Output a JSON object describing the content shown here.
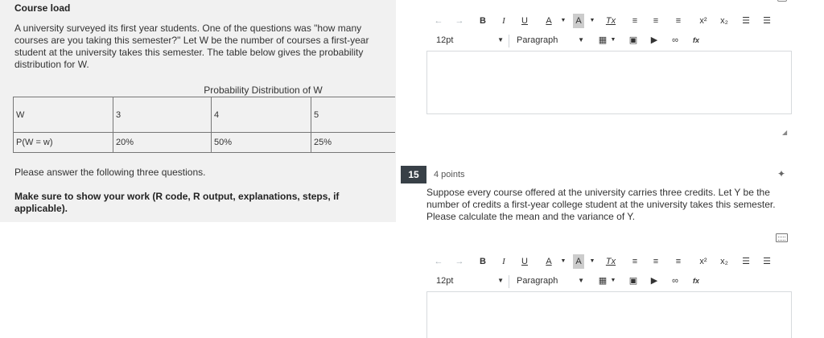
{
  "left": {
    "title": "Course load",
    "intro": "A university surveyed its first year students. One of the questions was \"how many courses are you taking this semester?\" Let W be the number of courses a first-year student at the university takes this semester. The table below gives the probability distribution for W.",
    "table_caption": "Probability Distribution of W",
    "table": {
      "rows": [
        [
          "W",
          "3",
          "4",
          "5"
        ],
        [
          "P(W = w)",
          "20%",
          "50%",
          "25%"
        ]
      ]
    },
    "ask": "Please answer the following three questions.",
    "instructions": "Make sure to show your work (R code, R output, explanations, steps, if applicable)."
  },
  "editor": {
    "font_size": "12pt",
    "block_format": "Paragraph",
    "buttons": {
      "bold": "B",
      "italic": "I",
      "underline": "U",
      "text_color": "A",
      "bg_color": "A",
      "clear_format": "Tx",
      "superscript": "x²",
      "subscript": "x₂",
      "equation": "fx"
    }
  },
  "question": {
    "number": "15",
    "points": "4 points",
    "text": "Suppose every course offered at the university carries three credits. Let Y be the number of credits a first-year college student at the university takes this semester. Please calculate the mean and the variance of Y."
  },
  "icons": {
    "undo": "undo-icon",
    "redo": "redo-icon",
    "align_left": "align-left-icon",
    "align_center": "align-center-icon",
    "align_right": "align-right-icon",
    "bullet_list": "bullet-list-icon",
    "numbered_list": "numbered-list-icon",
    "table": "table-icon",
    "image": "image-icon",
    "media": "media-icon",
    "link": "link-icon",
    "pin": "pin-icon",
    "keyboard": "keyboard-icon"
  }
}
